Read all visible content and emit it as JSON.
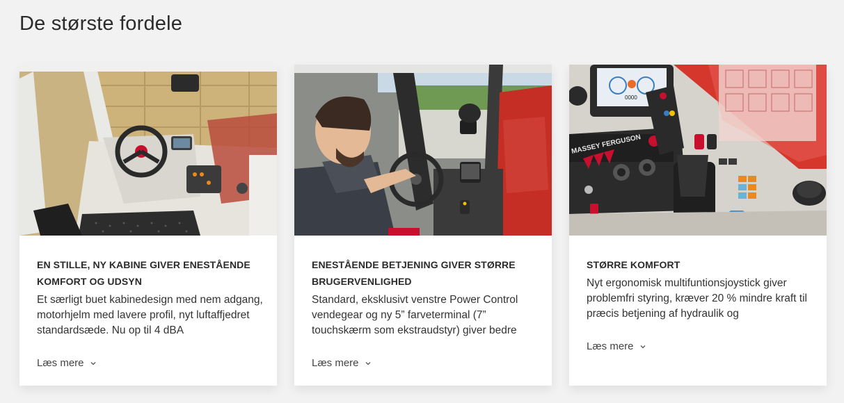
{
  "page": {
    "title": "De største fordele"
  },
  "cards": [
    {
      "heading": "EN STILLE, NY KABINE GIVER ENESTÅENDE KOMFORT OG UDSYN",
      "text": "Et særligt buet kabinedesign med nem adgang, motorhjelm med lavere profil, nyt luftaffjedret standardsæde. Nu op til 4 dBA",
      "link": "Læs mere",
      "image_alt": "Cabin interior with steering wheel and hay bales"
    },
    {
      "heading": "ENESTÅENDE BETJENING GIVER STØRRE BRUGERVENLIGHED",
      "text": "Standard, eksklusivt venstre Power Control vendegear og ny 5” farveterminal (7” touchskærm som ekstraudstyr) giver bedre",
      "link": "Læs mere",
      "image_alt": "Operator driving in cabin"
    },
    {
      "heading": "STØRRE KOMFORT",
      "text": "Nyt ergonomisk multifuntionsjoystick giver problemfri styring, kræver 20 % mindre kraft til præcis betjening af hydraulik og",
      "link": "Læs mere",
      "image_alt": "Massey Ferguson joystick and control panel",
      "brand_text": "MASSEY FERGUSON",
      "display_counter": "0000"
    }
  ],
  "colors": {
    "background": "#f2f2f2",
    "card": "#ffffff",
    "accent_red": "#c8102e"
  }
}
